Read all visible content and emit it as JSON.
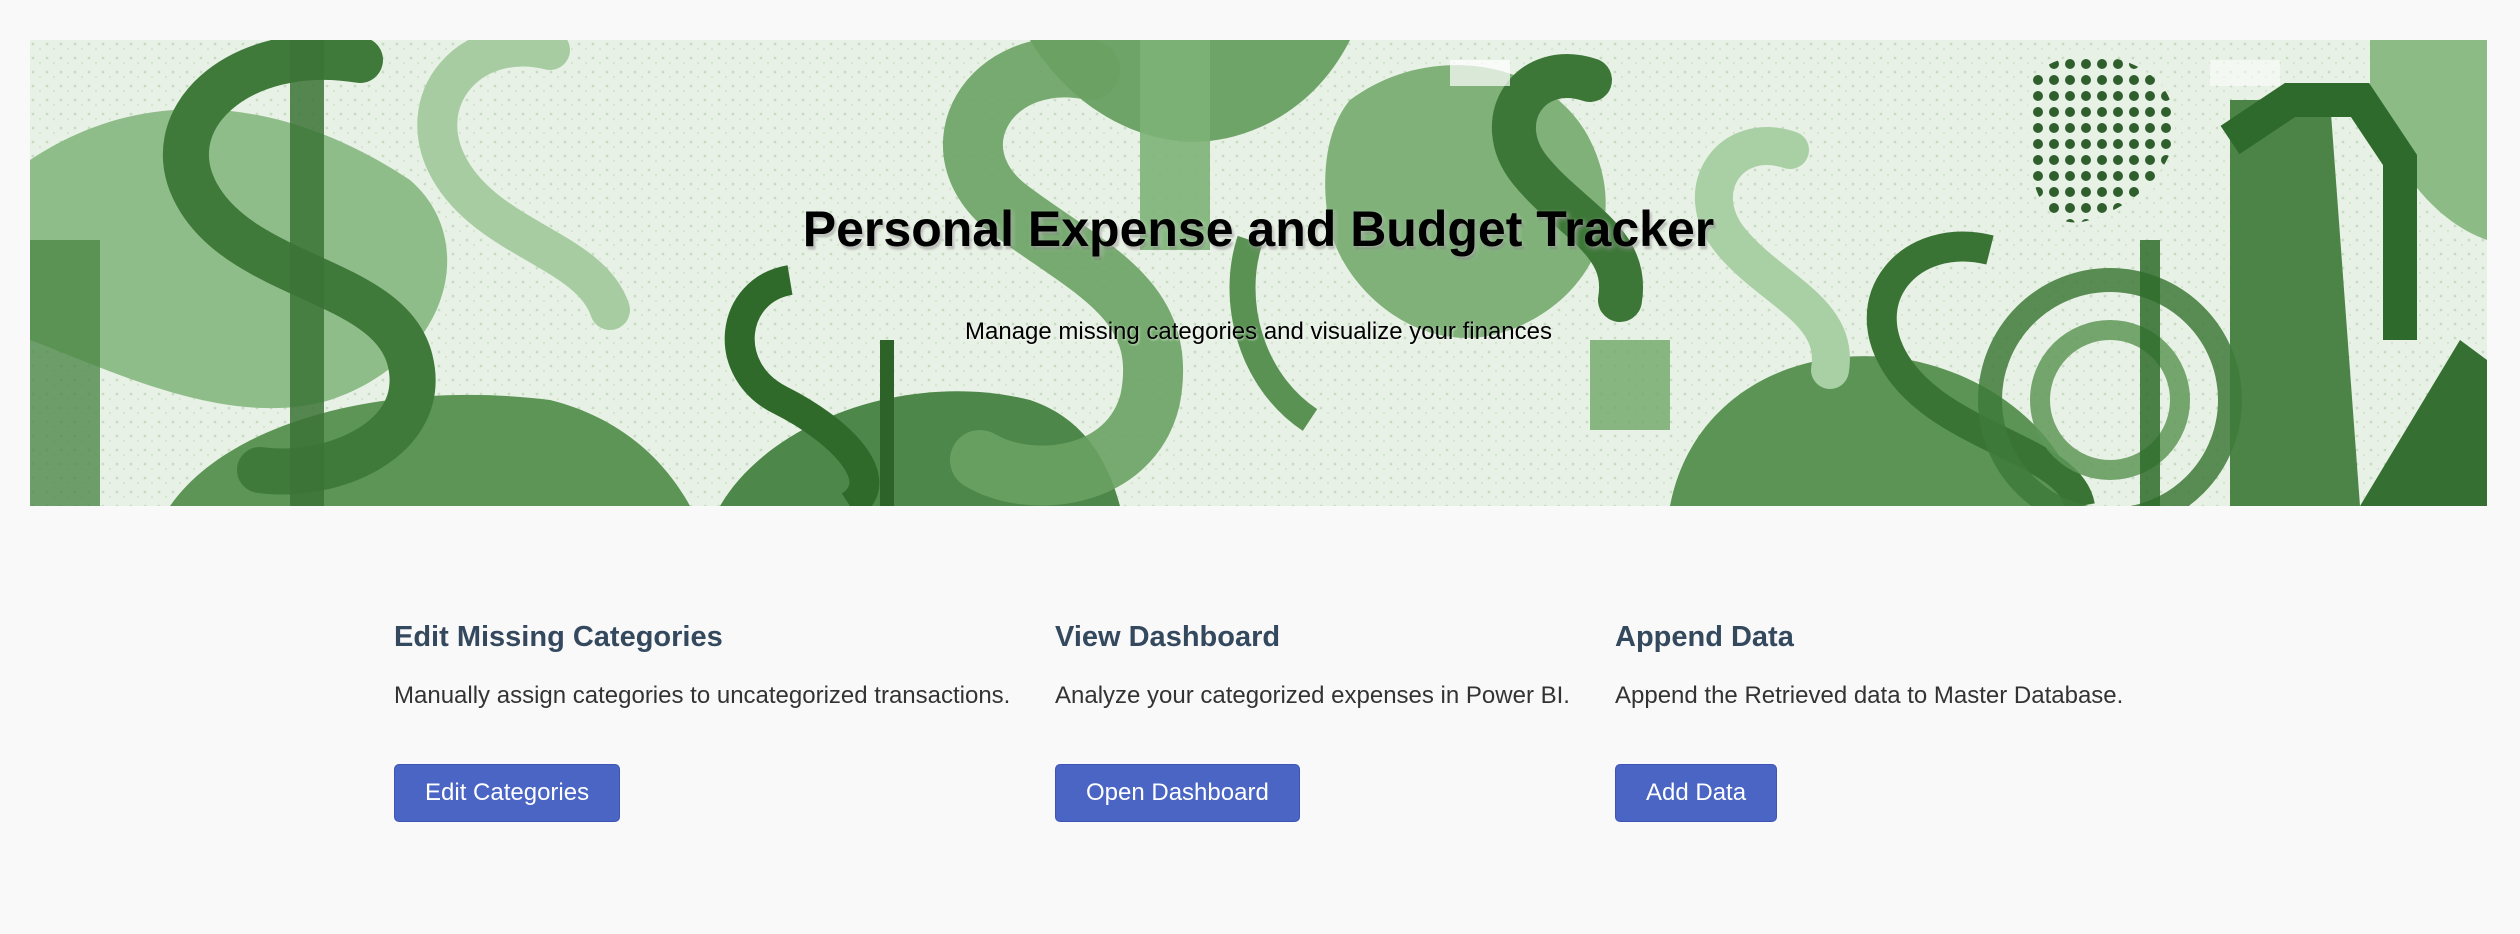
{
  "hero": {
    "title": "Personal Expense and Budget Tracker",
    "subtitle": "Manage missing categories and visualize your finances"
  },
  "cards": [
    {
      "heading": "Edit Missing Categories",
      "description": "Manually assign categories to uncategorized transactions.",
      "button_label": "Edit Categories"
    },
    {
      "heading": "View Dashboard",
      "description": "Analyze your categorized expenses in Power BI.",
      "button_label": "Open Dashboard"
    },
    {
      "heading": "Append Data",
      "description": "Append the Retrieved data to Master Database.",
      "button_label": "Add Data"
    }
  ],
  "colors": {
    "page_background": "#f9f9f9",
    "heading": "#34495e",
    "button": "#4a65c4",
    "hero_green_dark": "#3f7a3a",
    "hero_green_light": "#cfe3cb"
  },
  "icons": {
    "hero_image": "dollar-sign-pattern"
  }
}
